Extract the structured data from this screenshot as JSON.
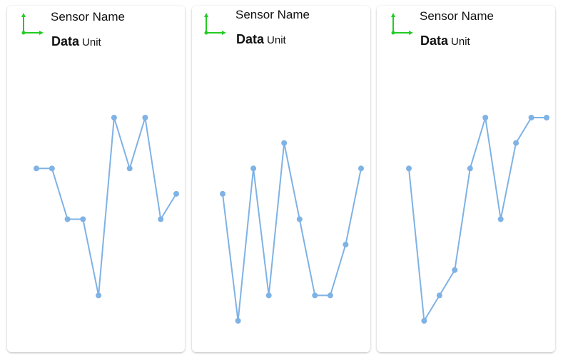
{
  "line_color": "#7fb2e5",
  "icon_color": "#22cc22",
  "cards": [
    {
      "sensor_name": "Sensor Name",
      "data_label": "Data",
      "unit_label": "Unit",
      "icon": "axis-icon",
      "chart_data": {
        "type": "line",
        "y": [
          4,
          4,
          2,
          2,
          -1,
          6,
          4,
          6,
          2,
          3
        ]
      }
    },
    {
      "sensor_name": "Sensor Name",
      "data_label": "Data",
      "unit_label": "Unit",
      "icon": "axis-icon",
      "chart_data": {
        "type": "line",
        "y": [
          3,
          -2,
          4,
          -1,
          5,
          2,
          -1,
          -1,
          1,
          4
        ]
      }
    },
    {
      "sensor_name": "Sensor Name",
      "data_label": "Data",
      "unit_label": "Unit",
      "icon": "axis-icon",
      "chart_data": {
        "type": "line",
        "y": [
          4,
          -2,
          -1,
          0,
          4,
          6,
          2,
          5,
          6,
          6
        ]
      }
    }
  ]
}
